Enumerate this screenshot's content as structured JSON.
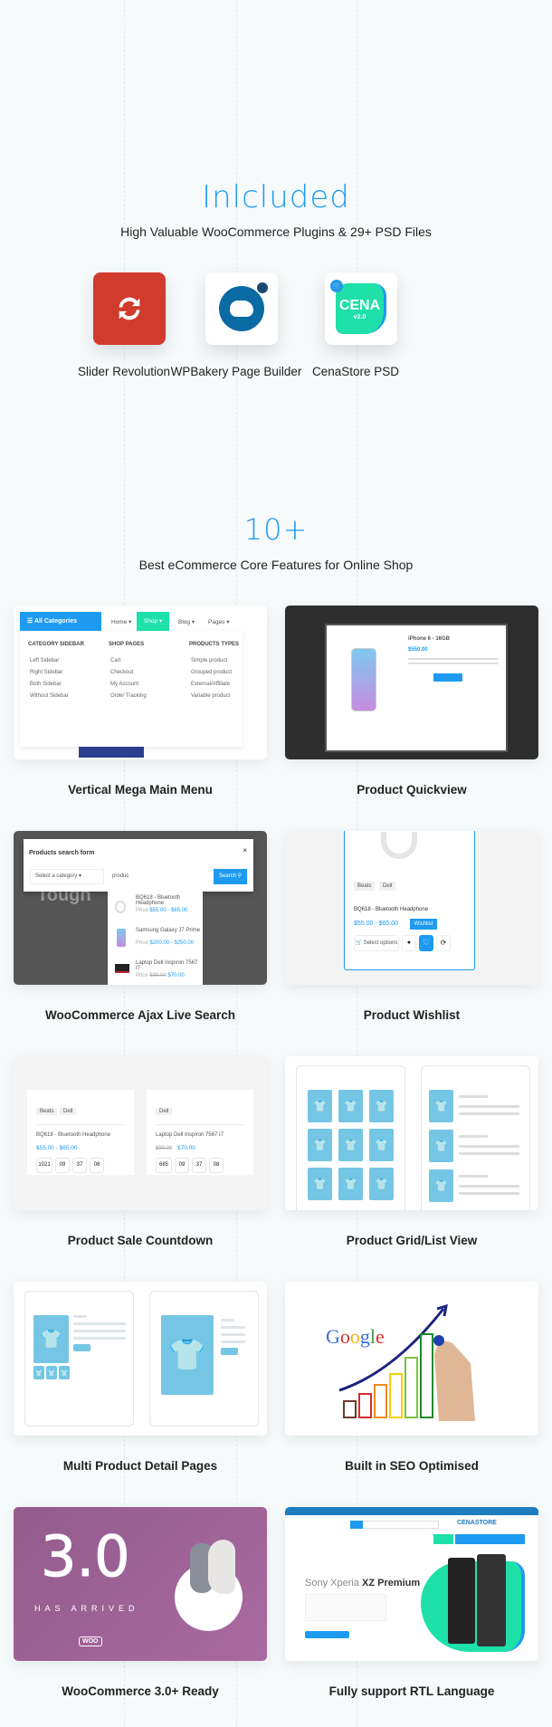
{
  "included": {
    "title": "Inlcluded",
    "subtitle": "High Valuable WooCommerce Plugins & 29+ PSD Files",
    "plugins": [
      {
        "label": "Slider Revolution",
        "icon": "refresh-icon",
        "color": "#d13b2c"
      },
      {
        "label": "WPBakery Page Builder",
        "icon": "wpbakery-cloud-icon",
        "color": "#0a6aa4"
      },
      {
        "label": "CenaStore PSD",
        "icon": "cena-logo",
        "logo_text": "CENA",
        "version": "v2.0",
        "color": "#1ee0a8"
      }
    ]
  },
  "features": {
    "title": "10+",
    "subtitle": "Best eCommerce Core Features for Online Shop",
    "items": [
      {
        "label": "Vertical Mega Main Menu"
      },
      {
        "label": "Product Quickview"
      },
      {
        "label": "WooCommerce Ajax Live Search"
      },
      {
        "label": "Product Wishlist"
      },
      {
        "label": "Product Sale Countdown"
      },
      {
        "label": "Product Grid/List View"
      },
      {
        "label": "Multi Product Detail Pages"
      },
      {
        "label": "Built in SEO Optimised"
      },
      {
        "label": "WooCommerce 3.0+ Ready"
      },
      {
        "label": "Fully support RTL Language"
      }
    ]
  },
  "mega_menu": {
    "all_categories": "All Categories",
    "nav": [
      "Home ▾",
      "Shop ▾",
      "Blog ▾",
      "Pages ▾"
    ],
    "columns": [
      {
        "heading": "CATEGORY SIDEBAR",
        "items": [
          "Left Sidebar",
          "Right Sidebar",
          "Both Sidebar",
          "Without Sidebar"
        ]
      },
      {
        "heading": "SHOP PAGES",
        "items": [
          "Cart",
          "Checkout",
          "My Account",
          "Order Tracking"
        ]
      },
      {
        "heading": "PRODUCTS TYPES",
        "items": [
          "Simple product",
          "Grouped product",
          "External/Affiliate",
          "Variable product"
        ]
      }
    ]
  },
  "quickview": {
    "product": "iPhone 6 - 16GB",
    "price": "$550.00"
  },
  "search": {
    "title": "Products search form",
    "category_placeholder": "Select a category",
    "query": "produc",
    "button": "Search",
    "bg_text": "Tough",
    "results": [
      {
        "name": "BQ618 - Bluetooth Headphone",
        "price_label": "Price",
        "price": "$55.00 - $65.00"
      },
      {
        "name": "Samsung Galaxy J7 Prime",
        "price_label": "Price",
        "price": "$200.00 - $250.00"
      },
      {
        "name": "Laptop Dell Inspiron 7567 I7",
        "price_label": "Price",
        "old_price": "$99.00",
        "price": "$70.00"
      }
    ]
  },
  "wishlist": {
    "tags": [
      "Beats",
      "Dell"
    ],
    "name": "BQ618 - Bluetooth Headphone",
    "price": "$55.00 - $65.00",
    "tooltip": "Wishlist",
    "select_options": "Select options"
  },
  "countdown": {
    "products": [
      {
        "tags": [
          "Beats",
          "Dell"
        ],
        "name": "BQ618 - Bluetooth Headphone",
        "price": "$55.00 - $65.00",
        "timer": [
          "1021",
          "09",
          "37",
          "08"
        ]
      },
      {
        "tags": [
          "Dell"
        ],
        "name": "Laptop Dell Inspiron 7567 I7",
        "old_price": "$99.00",
        "price": "$70.00",
        "timer": [
          "685",
          "09",
          "37",
          "08"
        ]
      }
    ]
  },
  "seo": {
    "logo": "Google"
  },
  "woo": {
    "version": "3.0",
    "tagline": "HAS ARRIVED",
    "badge": "WOO"
  },
  "rtl": {
    "headline_light": "Sony Xperia",
    "headline_bold": "XZ Premium",
    "brand": "CENASTORE"
  }
}
